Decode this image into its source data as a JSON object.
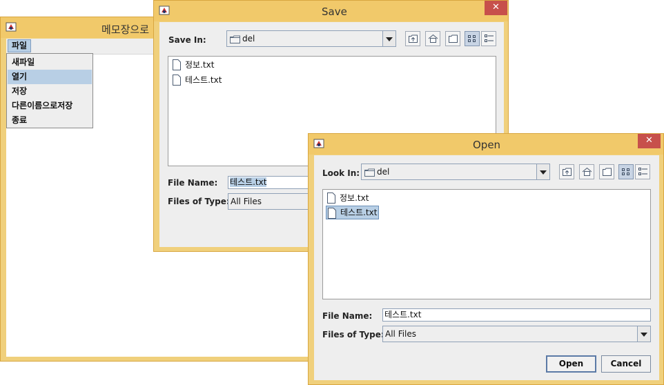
{
  "notepad": {
    "title": "메모장으로",
    "menu_title": "파일",
    "menu_items": [
      "새파일",
      "열기",
      "저장",
      "다른이름으로저장",
      "종료"
    ]
  },
  "save_dialog": {
    "title": "Save",
    "close_glyph": "✕",
    "look_in_label": "Save In:",
    "folder": "del",
    "files": [
      "정보.txt",
      "테스트.txt"
    ],
    "file_name_label": "File Name:",
    "file_name_value": "테스트.txt",
    "file_type_label": "Files of Type:",
    "file_type_value": "All Files"
  },
  "open_dialog": {
    "title": "Open",
    "close_glyph": "✕",
    "look_in_label": "Look In:",
    "folder": "del",
    "files": [
      "정보.txt",
      "테스트.txt"
    ],
    "selected_file_index": 1,
    "file_name_label": "File Name:",
    "file_name_value": "테스트.txt",
    "file_type_label": "Files of Type:",
    "file_type_value": "All Files",
    "open_button": "Open",
    "cancel_button": "Cancel"
  },
  "colors": {
    "title_bar": "#f1c96a",
    "close_button": "#c7504b",
    "selection": "#b8cfe5"
  }
}
